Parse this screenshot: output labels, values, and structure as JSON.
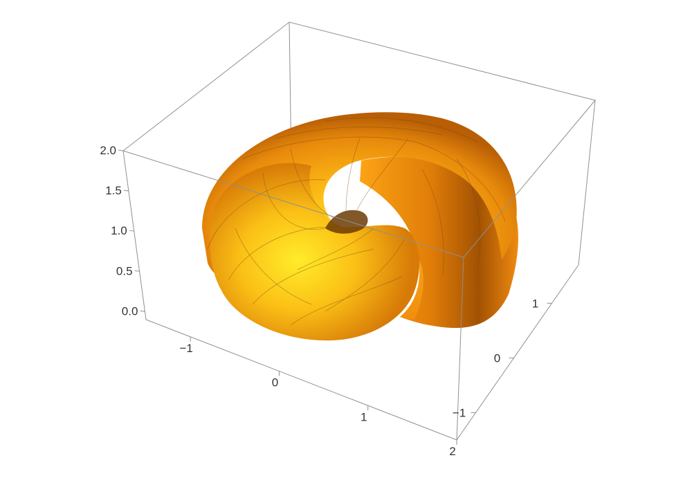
{
  "chart_data": {
    "type": "surface3d",
    "title": "",
    "surface_description": "spiral seashell surface",
    "surface_color": "#f59a12",
    "axes": {
      "x": {
        "ticks": [
          -1,
          0,
          1,
          2
        ],
        "tick_labels": [
          "−1",
          "0",
          "1",
          "2"
        ],
        "range": [
          -1.5,
          2
        ]
      },
      "y": {
        "ticks": [
          -1,
          0,
          1
        ],
        "tick_labels": [
          "−1",
          "0",
          "1"
        ],
        "range": [
          -1.5,
          1.7
        ]
      },
      "z": {
        "ticks": [
          0.0,
          0.5,
          1.0,
          1.5,
          2.0
        ],
        "tick_labels": [
          "0.0",
          "0.5",
          "1.0",
          "1.5",
          "2.0"
        ],
        "range": [
          -0.1,
          2.0
        ]
      }
    },
    "box": true,
    "grid": false
  }
}
